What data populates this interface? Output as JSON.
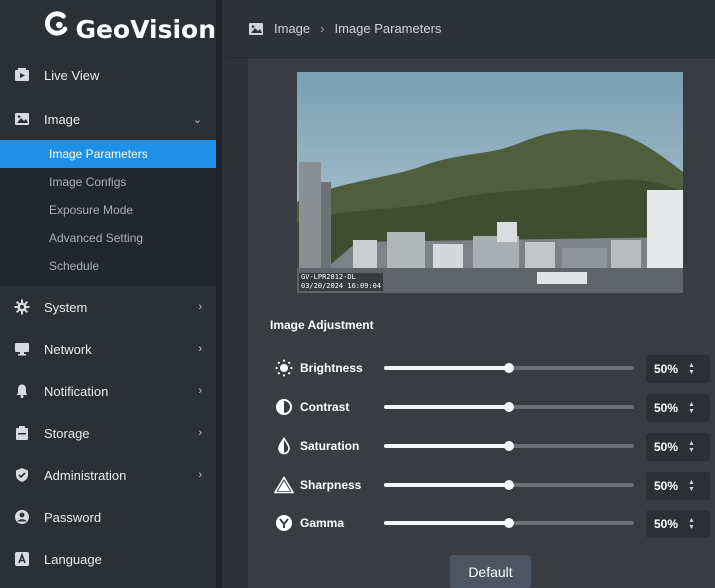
{
  "brand": {
    "name": "GeoVision"
  },
  "sidebar": {
    "items": [
      {
        "label": "Live View",
        "icon": "live-view-icon"
      },
      {
        "label": "Image",
        "icon": "image-icon"
      },
      {
        "label": "System",
        "icon": "gear-icon"
      },
      {
        "label": "Network",
        "icon": "monitor-icon"
      },
      {
        "label": "Notification",
        "icon": "bell-icon"
      },
      {
        "label": "Storage",
        "icon": "storage-icon"
      },
      {
        "label": "Administration",
        "icon": "shield-icon"
      },
      {
        "label": "Password",
        "icon": "user-icon"
      },
      {
        "label": "Language",
        "icon": "language-icon"
      }
    ],
    "image_submenu": [
      "Image Parameters",
      "Image Configs",
      "Exposure Mode",
      "Advanced Setting",
      "Schedule"
    ]
  },
  "breadcrumb": {
    "section": "Image",
    "page": "Image Parameters"
  },
  "preview": {
    "overlay_line1": "GV-LPR2812-DL",
    "overlay_line2": "03/20/2024  16:09:04"
  },
  "adjustment": {
    "title": "Image Adjustment",
    "rows": [
      {
        "label": "Brightness",
        "value": "50%",
        "level": 0.5,
        "icon": "sun-icon"
      },
      {
        "label": "Contrast",
        "value": "50%",
        "level": 0.5,
        "icon": "contrast-icon"
      },
      {
        "label": "Saturation",
        "value": "50%",
        "level": 0.5,
        "icon": "droplet-icon"
      },
      {
        "label": "Sharpness",
        "value": "50%",
        "level": 0.5,
        "icon": "triangle-icon"
      },
      {
        "label": "Gamma",
        "value": "50%",
        "level": 0.5,
        "icon": "gamma-icon"
      }
    ]
  },
  "buttons": {
    "default_label": "Default"
  },
  "colors": {
    "accent": "#1e90e8",
    "sidebar_bg": "#2b3035",
    "panel_bg": "#393d42"
  }
}
